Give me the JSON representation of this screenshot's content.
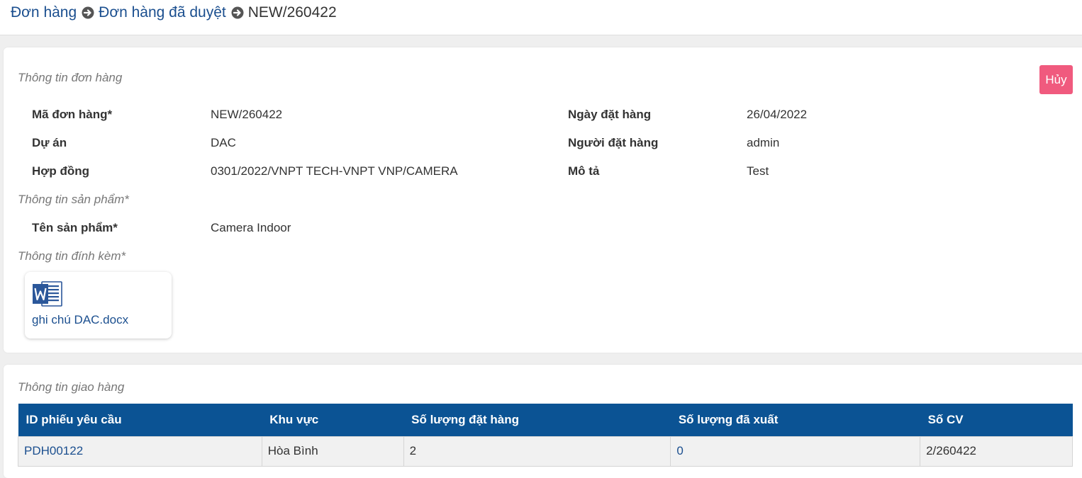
{
  "breadcrumb": {
    "items": [
      "Đơn hàng",
      "Đơn hàng đã duyệt"
    ],
    "current": "NEW/260422"
  },
  "order": {
    "section_title": "Thông tin đơn hàng",
    "cancel_label": "Hủy",
    "fields": {
      "code_label": "Mã đơn hàng*",
      "code_value": "NEW/260422",
      "project_label": "Dự án",
      "project_value": "DAC",
      "contract_label": "Hợp đồng",
      "contract_value": "0301/2022/VNPT TECH-VNPT VNP/CAMERA",
      "order_date_label": "Ngày đặt hàng",
      "order_date_value": "26/04/2022",
      "orderer_label": "Người đặt hàng",
      "orderer_value": "admin",
      "description_label": "Mô tả",
      "description_value": "Test"
    },
    "product_section_title": "Thông tin sản phẩm*",
    "product_name_label": "Tên sản phẩm*",
    "product_name_value": "Camera Indoor",
    "attachment_section_title": "Thông tin đính kèm*",
    "attachment": {
      "icon": "word-doc-icon",
      "file_name": "ghi chú DAC.docx"
    }
  },
  "delivery": {
    "section_title": "Thông tin giao hàng",
    "columns": [
      "ID phiếu yêu cầu",
      "Khu vực",
      "Số lượng đặt hàng",
      "Số lượng đã xuất",
      "Số CV"
    ],
    "rows": [
      [
        "PDH00122",
        "Hòa Bình",
        "2",
        "0",
        "2/260422"
      ]
    ]
  },
  "colors": {
    "link": "#1b4f8f",
    "table_header": "#0b5394",
    "cancel_button": "#f05a7e"
  }
}
